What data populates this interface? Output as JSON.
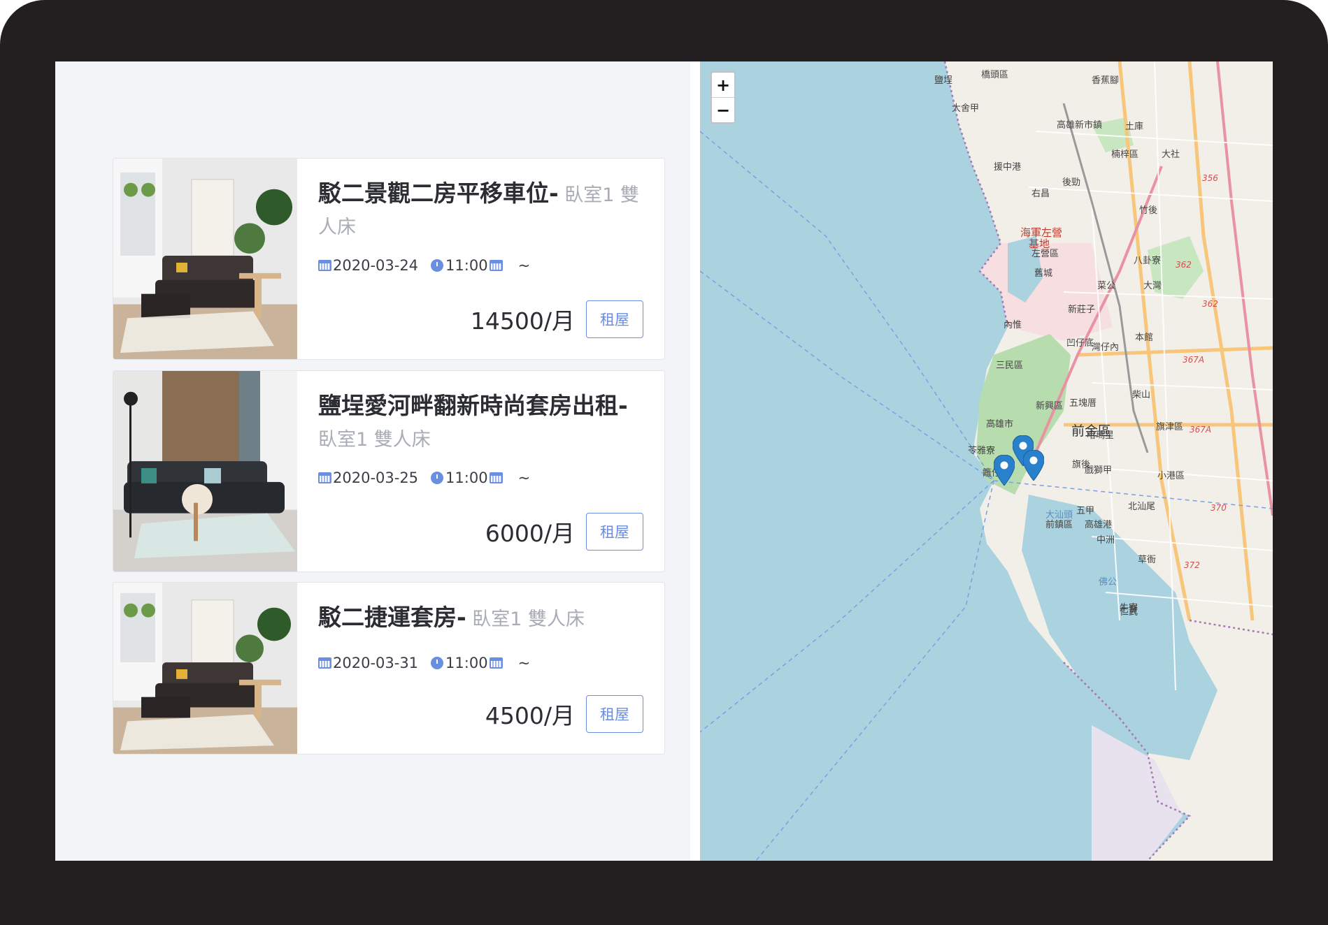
{
  "listings": [
    {
      "title": "駁二景觀二房平移車位-",
      "subtitle": "臥室1 雙人床",
      "date": "2020-03-24",
      "time": "11:00",
      "tilde": "~",
      "price": "14500/月",
      "button_label": "租屋"
    },
    {
      "title": "鹽埕愛河畔翻新時尚套房出租-",
      "subtitle": "臥室1 雙人床",
      "date": "2020-03-25",
      "time": "11:00",
      "tilde": "~",
      "price": "6000/月",
      "button_label": "租屋"
    },
    {
      "title": "駁二捷運套房-",
      "subtitle": "臥室1 雙人床",
      "date": "2020-03-31",
      "time": "11:00",
      "tilde": "~",
      "price": "4500/月",
      "button_label": "租屋"
    }
  ],
  "map": {
    "zoom_in": "+",
    "zoom_out": "−",
    "labels": [
      "橋頭區",
      "香蕉腳",
      "大舍甲",
      "高雄新市鎮",
      "土庫",
      "大社",
      "鹽埕",
      "援中港",
      "楠梓區",
      "後勁",
      "竹後",
      "右昌",
      "海軍左營",
      "基地",
      "左營區",
      "八卦寮",
      "舊城",
      "菜公",
      "大灣",
      "新莊子",
      "內惟",
      "本館",
      "凹仔底",
      "灣仔內",
      "三民區",
      "柴山",
      "五塊厝",
      "新興區",
      "前金區",
      "高雄市",
      "哈瑪星",
      "苓雅寮",
      "旗後",
      "戲獅甲",
      "籬仔內",
      "北汕尾",
      "五甲",
      "大汕頭",
      "前鎮區",
      "高雄港",
      "中洲",
      "草衙",
      "佛公",
      "小港區",
      "旗津區",
      "仁武",
      "七賢",
      "牛寮"
    ],
    "route_labels": [
      "356",
      "362",
      "362",
      "367A",
      "367A",
      "370",
      "372"
    ],
    "water_color": "#aad3df",
    "land_color": "#f2efe9",
    "marker_color": "#2a81cb"
  }
}
